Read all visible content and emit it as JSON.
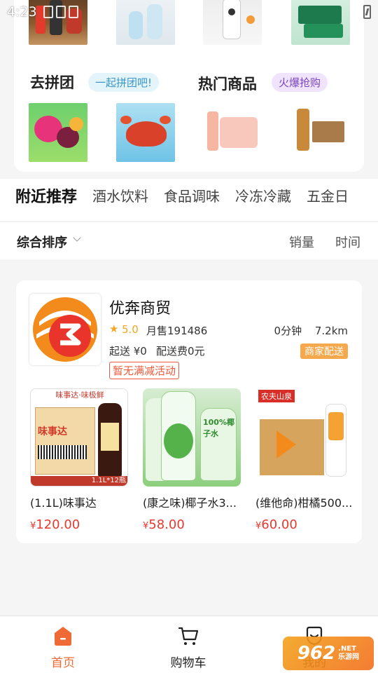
{
  "status": {
    "time": "4:23"
  },
  "featured": {
    "group_title": "去拼团",
    "group_pill": "一起拼团吧!",
    "hot_title": "热门商品",
    "hot_pill": "火爆抢购"
  },
  "category_tabs": [
    "附近推荐",
    "酒水饮料",
    "食品调味",
    "冷冻冷藏",
    "五金日"
  ],
  "sort": {
    "main": "综合排序",
    "sales": "销量",
    "time": "时间"
  },
  "shop": {
    "name": "优奔商贸",
    "rating": "5.0",
    "monthly_sales": "月售191486",
    "time_distance": "0分钟 7.2km",
    "min_order": "起送 ¥0",
    "delivery_fee": "配送费0元",
    "delivery_badge": "商家配送",
    "promo": "暂无满减活动",
    "products": [
      {
        "name": "(1.1L)味事达",
        "price": "120.00",
        "img_label": "味事达·味极鲜",
        "img_sub": "1.1L*12瓶"
      },
      {
        "name": "(康之味)椰子水3...",
        "price": "58.00",
        "img_label": "100%椰子水"
      },
      {
        "name": "(维他命)柑橘500...",
        "price": "60.00",
        "img_label": "农夫山泉"
      }
    ]
  },
  "bottom_nav": {
    "home": "首页",
    "cart": "购物车",
    "mine": "我的"
  },
  "watermark": {
    "num": "962",
    "net": ".NET",
    "site": "乐游网"
  },
  "colors": {
    "accent": "#f06a35",
    "price": "#e8382f",
    "badge": "#f6a84c"
  }
}
